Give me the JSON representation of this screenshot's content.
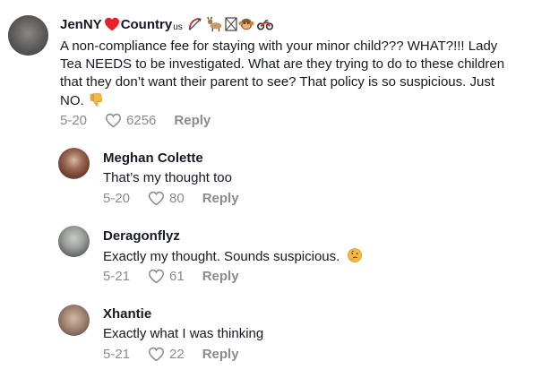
{
  "comments": [
    {
      "username": "JenNY",
      "username_suffix": "Country",
      "username_sub": "us",
      "text": "A non-compliance fee for staying with your minor child??? WHAT?!!! Lady Tea NEEDS to be investigated. What are they trying to do to these children that they don’t want their parent to see? That policy is so suspicious. Just NO.",
      "date": "5-20",
      "likes": "6256",
      "reply_label": "Reply"
    }
  ],
  "replies": [
    {
      "username": "Meghan Colette",
      "text": "That’s my thought too",
      "date": "5-20",
      "likes": "80",
      "reply_label": "Reply"
    },
    {
      "username": "Deragonflyz",
      "text": "Exactly my thought. Sounds suspicious.",
      "date": "5-21",
      "likes": "61",
      "reply_label": "Reply"
    },
    {
      "username": "Xhantie",
      "text": "Exactly what I was thinking",
      "date": "5-21",
      "likes": "22",
      "reply_label": "Reply"
    }
  ],
  "colors": {
    "text": "#161823",
    "muted": "#8a8b91",
    "heart_red": "#e8212b"
  },
  "icons": [
    "heart-icon",
    "bow-arrow-icon",
    "goat-icon",
    "box-icon",
    "monkey-icon",
    "motorcycle-icon",
    "thumbs-down-icon",
    "thinking-face-icon",
    "like-heart-icon"
  ]
}
